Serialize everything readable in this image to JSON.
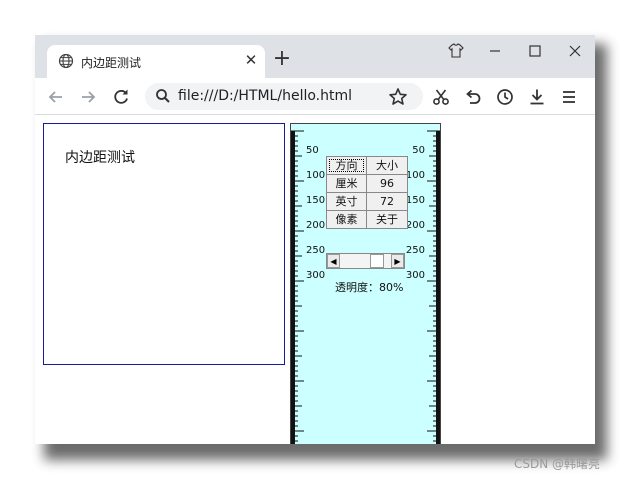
{
  "browser": {
    "tab": {
      "title": "内边距测试",
      "icon": "globe-icon"
    },
    "window_buttons": [
      "shirt-icon",
      "minimize-icon",
      "maximize-icon",
      "close-icon"
    ],
    "address": {
      "url": "file:///D:/HTML/hello.html"
    },
    "toolbar_icons": [
      "back-icon",
      "forward-icon",
      "reload-icon",
      "search-icon",
      "star-icon",
      "scissors-icon",
      "undo-icon",
      "history-icon",
      "download-icon",
      "menu-icon"
    ]
  },
  "page": {
    "padding_text": "内边距测试"
  },
  "ruler_tool": {
    "buttons": [
      [
        "方向",
        "大小"
      ],
      [
        "厘米",
        "96"
      ],
      [
        "英寸",
        "72"
      ],
      [
        "像素",
        "关于"
      ]
    ],
    "labels": [
      "50",
      "100",
      "150",
      "200",
      "250",
      "300"
    ],
    "opacity_label": "透明度：80%",
    "opacity_value": 80,
    "colors": {
      "background": "#ccffff"
    }
  },
  "watermark": "CSDN @韩曙亮"
}
